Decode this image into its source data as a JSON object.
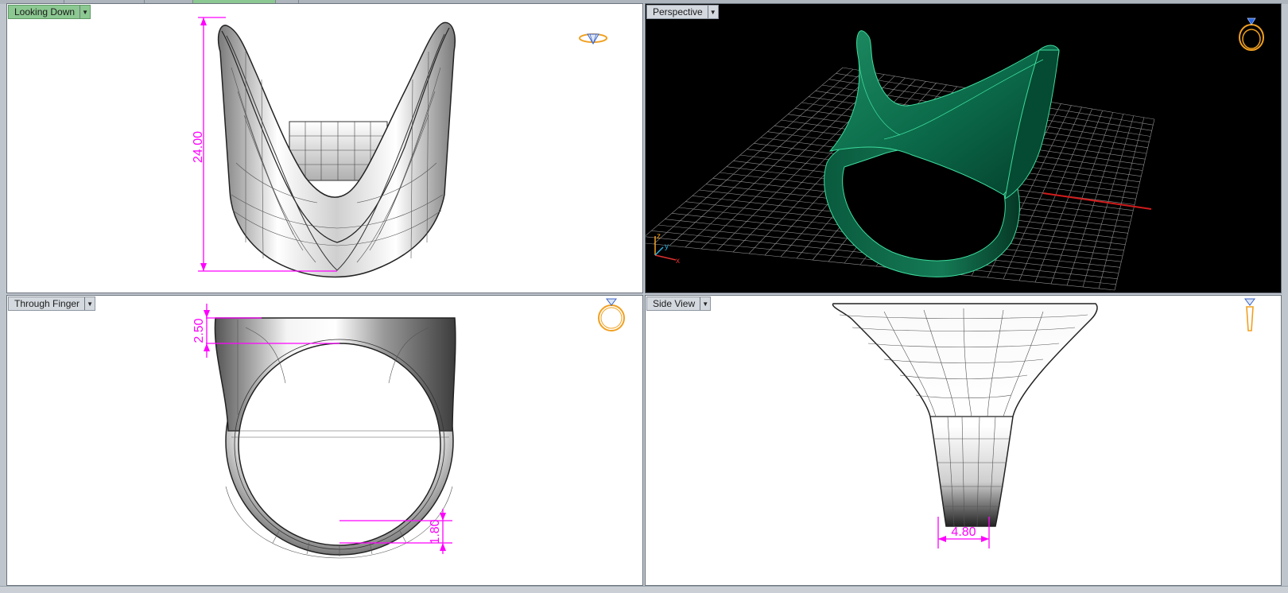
{
  "viewports": {
    "top_left": {
      "label": "Looking Down",
      "dimension": "24.00",
      "active": true
    },
    "top_right": {
      "label": "Perspective",
      "axis_x": "x",
      "axis_y": "y",
      "axis_z": "z"
    },
    "bottom_left": {
      "label": "Through Finger",
      "dimension_top": "2.50",
      "dimension_bottom": "1.80"
    },
    "bottom_right": {
      "label": "Side View",
      "dimension": "4.80"
    }
  },
  "icons": {
    "top_left": "ring-top-view-icon",
    "top_right": "ring-perspective-icon",
    "bottom_left": "ring-front-view-icon",
    "bottom_right": "ring-side-view-icon"
  },
  "colors": {
    "dimension": "#ff00ff",
    "ring_render": "#0b6b4a",
    "grid": "#9a9a9a",
    "x_axis": "#d11b1b",
    "active_label": "#8cc891",
    "nav_icon": "#f0a020"
  }
}
